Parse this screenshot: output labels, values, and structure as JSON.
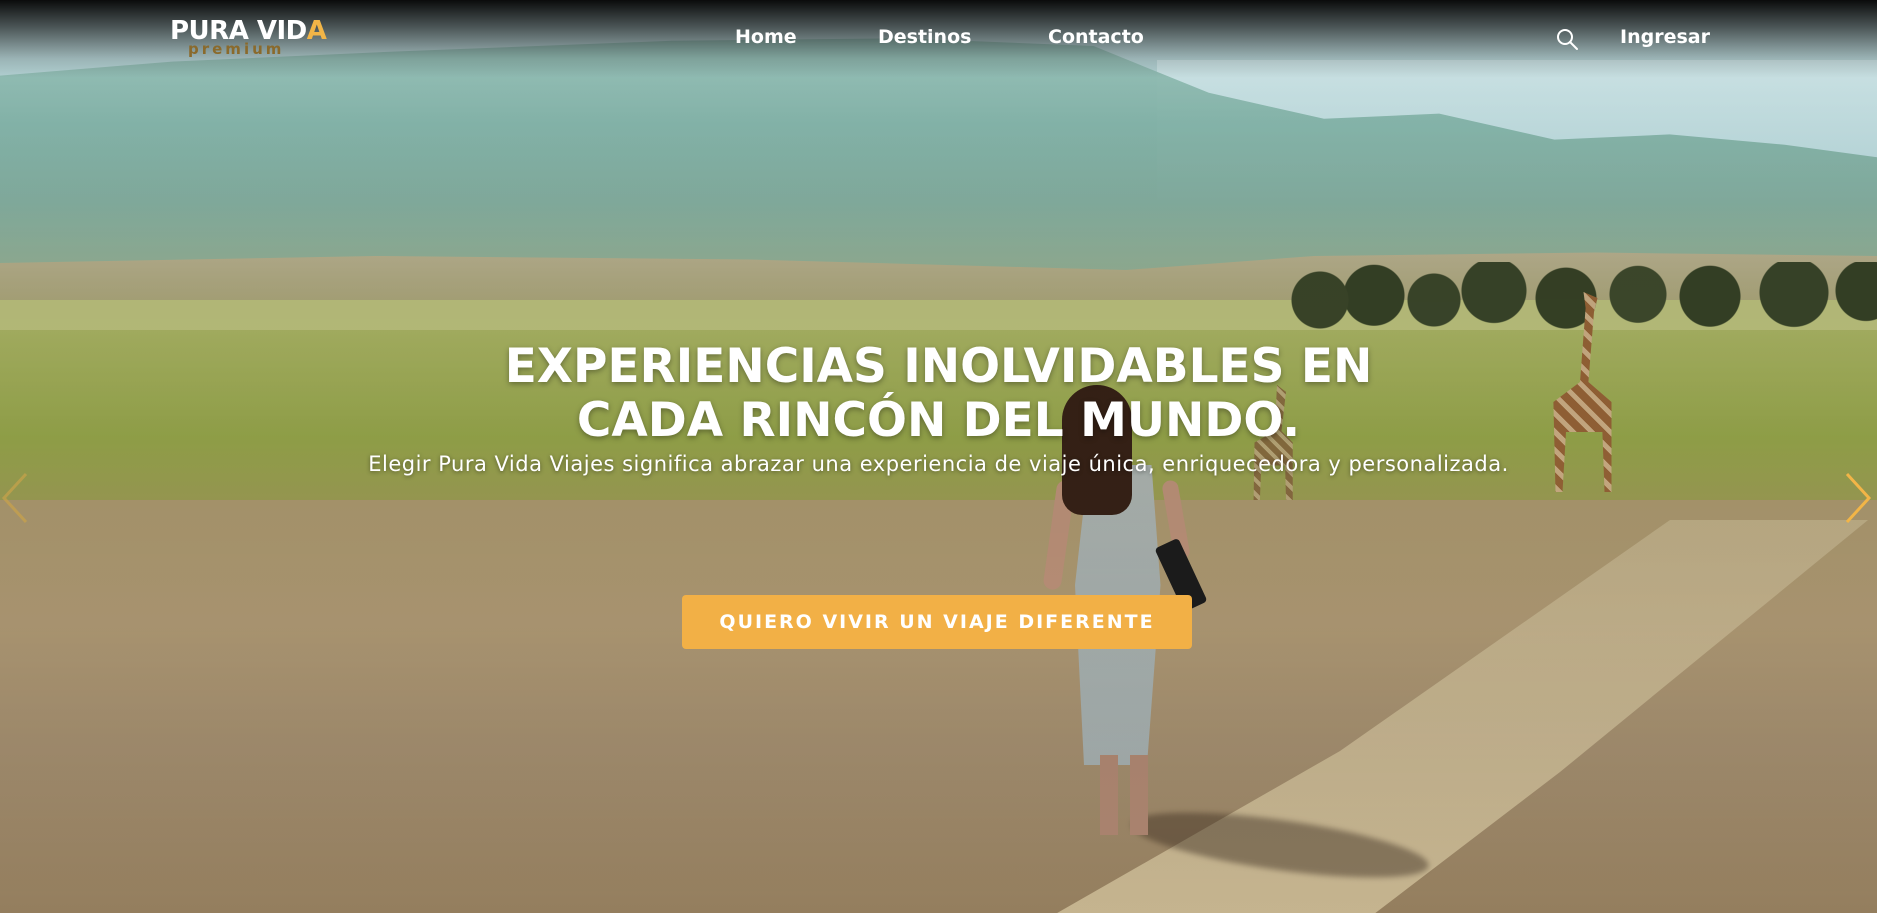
{
  "brand": {
    "name_main": "PURA VID",
    "name_accent": "A",
    "tagline": "premium",
    "accent_color": "#f2b547"
  },
  "nav": {
    "items": [
      {
        "label": "Home"
      },
      {
        "label": "Destinos"
      },
      {
        "label": "Contacto"
      }
    ],
    "search_icon": "search-icon",
    "login_label": "Ingresar"
  },
  "hero": {
    "headline_line1": "EXPERIENCIAS INOLVIDABLES EN",
    "headline_line2": "CADA RINCÓN DEL MUNDO.",
    "subtitle": "Elegir Pura Vida Viajes significa abrazar una experiencia de viaje única, enriquecedora y personalizada.",
    "cta_label": "QUIERO VIVIR UN VIAJE DIFERENTE",
    "cta_color": "#f2b046",
    "prev_icon": "chevron-left-icon",
    "next_icon": "chevron-right-icon",
    "arrow_color": "#f2b547"
  }
}
